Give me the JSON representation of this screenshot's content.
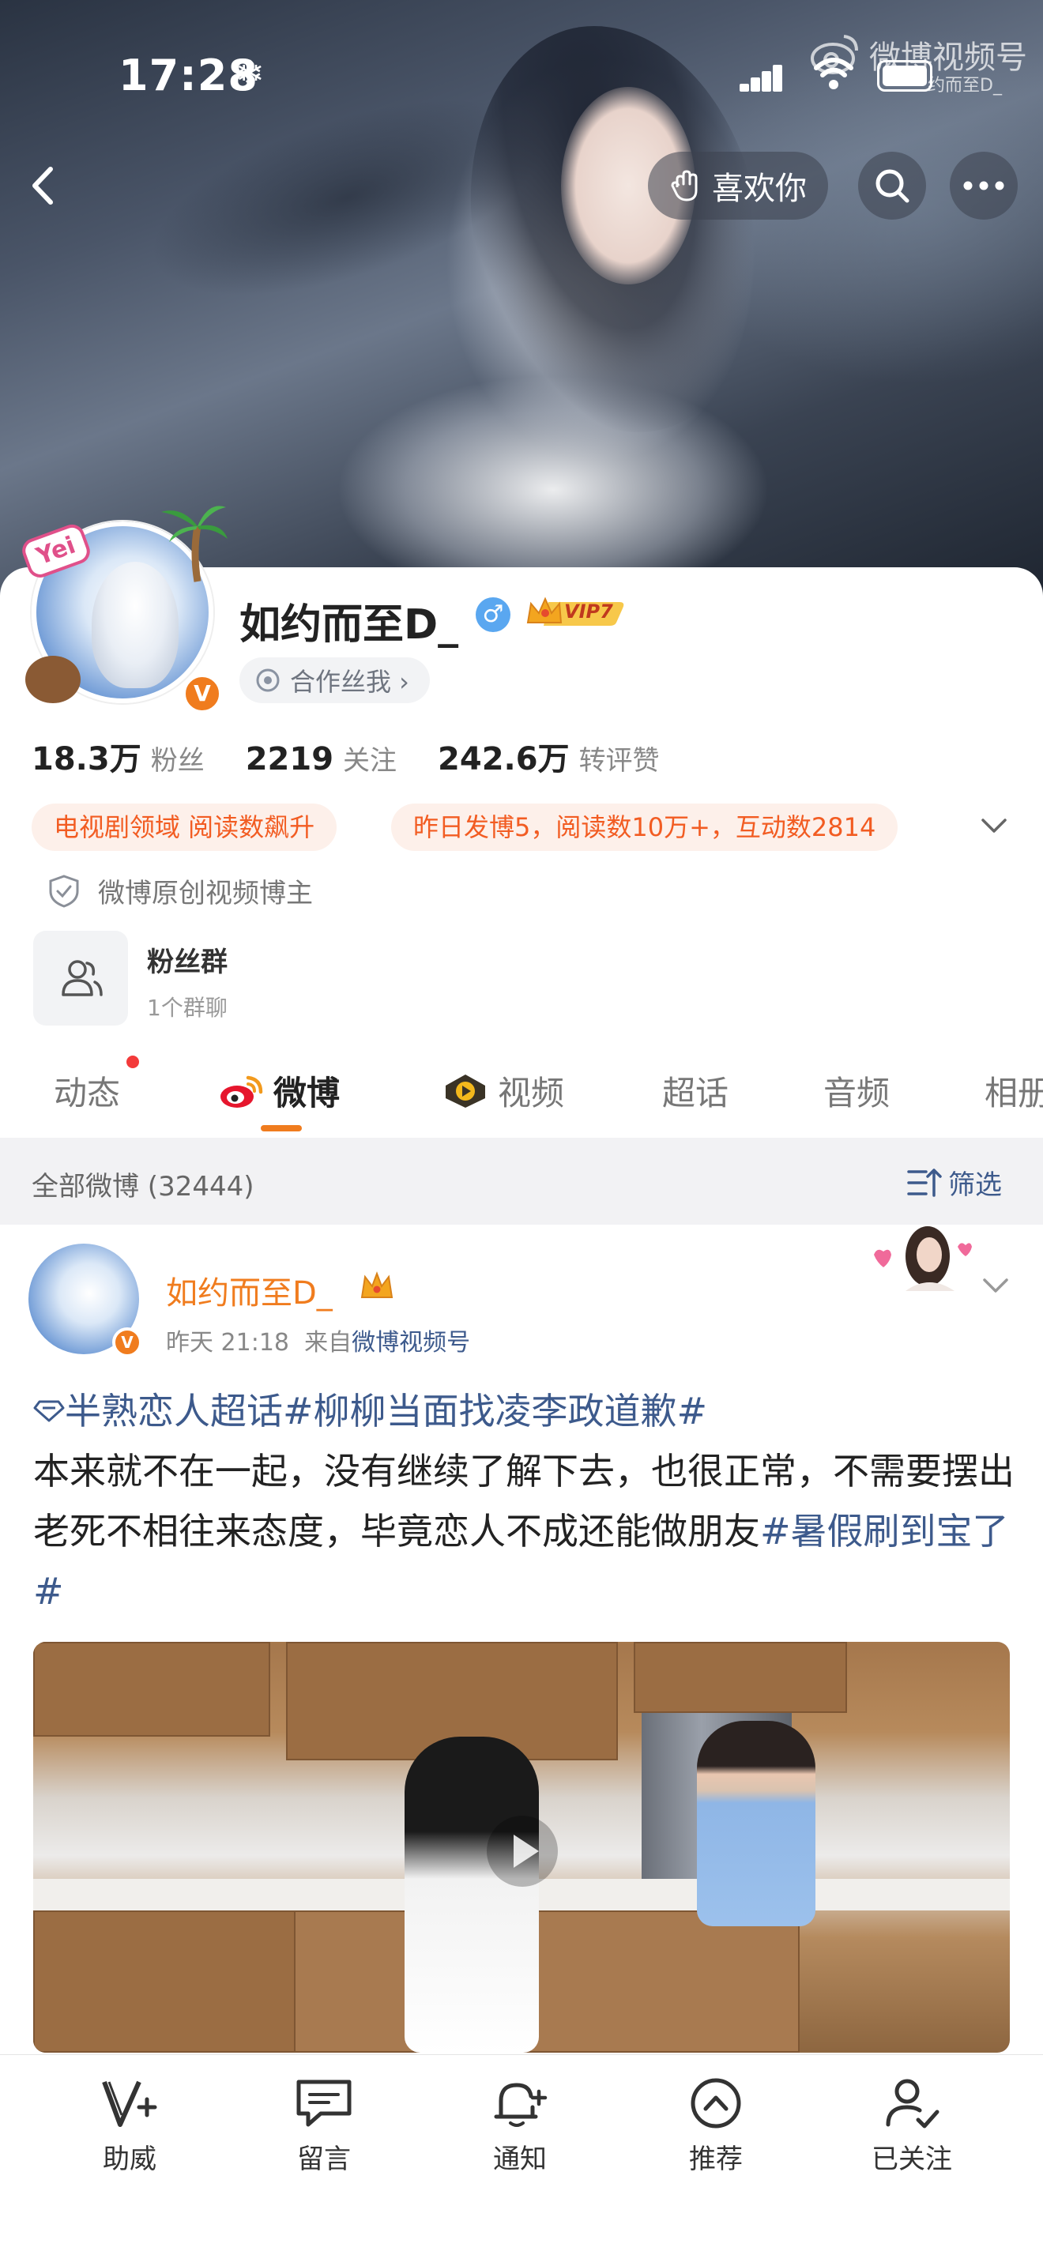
{
  "status_bar": {
    "time": "17:28"
  },
  "watermark": {
    "title": "微博视频号",
    "account": "约而至D_"
  },
  "header": {
    "like_label": "喜欢你"
  },
  "profile": {
    "name": "如约而至D_",
    "gender_symbol": "♂",
    "vip_label": "VIP7",
    "avatar_badge": "Yei",
    "verified_badge": "V",
    "cooperation_label": "合作丝我 ›",
    "stats": [
      {
        "value": "18.3万",
        "label": "粉丝"
      },
      {
        "value": "2219",
        "label": "关注"
      },
      {
        "value": "242.6万",
        "label": "转评赞"
      }
    ],
    "tags": [
      "电视剧领域 阅读数飙升",
      "昨日发博5，阅读数10万+，互动数2814"
    ],
    "original_creator": "微博原创视频博主",
    "fan_group": {
      "title": "粉丝群",
      "subtitle": "1个群聊"
    }
  },
  "tabs": [
    {
      "label": "动态",
      "active": false
    },
    {
      "label": "微博",
      "active": true
    },
    {
      "label": "视频",
      "active": false
    },
    {
      "label": "超话",
      "active": false
    },
    {
      "label": "音频",
      "active": false
    },
    {
      "label": "相册",
      "active": false
    }
  ],
  "filter": {
    "summary": "全部微博 (32444)",
    "button": "筛选"
  },
  "post": {
    "author": "如约而至D_",
    "time": "昨天 21:18",
    "source_prefix": "来自",
    "source": "微博视频号",
    "topic1": "半熟恋人超话",
    "topic2": "#柳柳当面找凌李政道歉#",
    "text": "本来就不在一起，没有继续了解下去，也很正常，不需要摆出老死不相往来态度，毕竟恋人不成还能做朋友",
    "topic3": "#暑假刷到宝了#"
  },
  "toolbar": [
    {
      "label": "助威",
      "icon": "v-plus-icon"
    },
    {
      "label": "留言",
      "icon": "message-icon"
    },
    {
      "label": "通知",
      "icon": "bell-plus-icon"
    },
    {
      "label": "推荐",
      "icon": "up-circle-icon"
    },
    {
      "label": "已关注",
      "icon": "user-check-icon"
    }
  ]
}
